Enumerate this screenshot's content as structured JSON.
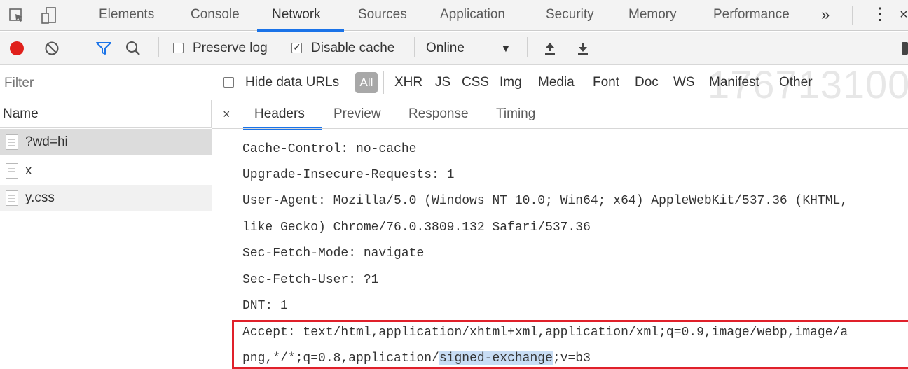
{
  "tabs": [
    {
      "label": "Elements",
      "active": false
    },
    {
      "label": "Console",
      "active": false
    },
    {
      "label": "Network",
      "active": true
    },
    {
      "label": "Sources",
      "active": false
    },
    {
      "label": "Application",
      "active": false
    },
    {
      "label": "Security",
      "active": false
    },
    {
      "label": "Memory",
      "active": false
    },
    {
      "label": "Performance",
      "active": false
    }
  ],
  "more_tabs_icon": "»",
  "menu_icon": "⋮",
  "toolbar": {
    "preserve_log": {
      "label": "Preserve log",
      "checked": false
    },
    "disable_cache": {
      "label": "Disable cache",
      "checked": true
    },
    "throttling": "Online",
    "record_color": "#e0201b",
    "filter_icon_color": "#1a73e8"
  },
  "filterbar": {
    "filter_placeholder": "Filter",
    "hide_data_urls": "Hide data URLs",
    "types": [
      "All",
      "XHR",
      "JS",
      "CSS",
      "Img",
      "Media",
      "Font",
      "Doc",
      "WS",
      "Manifest",
      "Other"
    ],
    "watermark": "176713100"
  },
  "requests": {
    "column": "Name",
    "items": [
      {
        "name": "?wd=hi",
        "selected": true
      },
      {
        "name": "x",
        "selected": false
      },
      {
        "name": "y.css",
        "selected": false
      }
    ]
  },
  "details": {
    "close": "×",
    "tabs": [
      {
        "label": "Headers",
        "active": true
      },
      {
        "label": "Preview",
        "active": false
      },
      {
        "label": "Response",
        "active": false
      },
      {
        "label": "Timing",
        "active": false
      }
    ],
    "lines": [
      "Cache-Control: no-cache",
      "Upgrade-Insecure-Requests: 1",
      "User-Agent: Mozilla/5.0 (Windows NT 10.0; Win64; x64) AppleWebKit/537.36 (KHTML,",
      "like Gecko) Chrome/76.0.3809.132 Safari/537.36",
      "Sec-Fetch-Mode: navigate",
      "Sec-Fetch-User: ?1",
      "DNT: 1",
      "Accept: text/html,application/xhtml+xml,application/xml;q=0.9,image/webp,image/a"
    ],
    "last_line": {
      "before": "png,*/*;q=0.8,application/",
      "highlight": "signed-exchange",
      "after": ";v=b3"
    },
    "highlight_color": "#e0202a"
  }
}
